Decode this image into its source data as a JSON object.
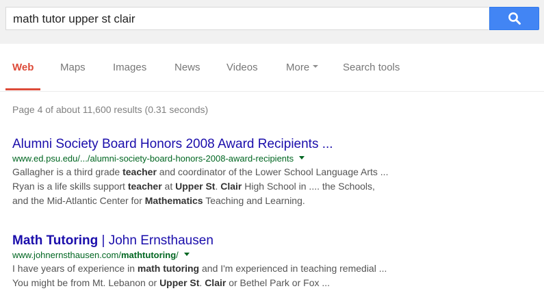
{
  "search": {
    "query": "math tutor upper st clair"
  },
  "nav": {
    "tabs": [
      {
        "label": "Web"
      },
      {
        "label": "Maps"
      },
      {
        "label": "Images"
      },
      {
        "label": "News"
      },
      {
        "label": "Videos"
      },
      {
        "label": "More"
      },
      {
        "label": "Search tools"
      }
    ]
  },
  "stats": "Page 4 of about 11,600 results (0.31 seconds)",
  "results": [
    {
      "title": "Alumni Society Board Honors 2008 Award Recipients ...",
      "url": "www.ed.psu.edu/.../alumni-society-board-honors-2008-award-recipients",
      "snippet": [
        [
          {
            "t": "Gallagher is a third grade "
          },
          {
            "t": "teacher",
            "b": true
          },
          {
            "t": " and coordinator of the Lower School Language Arts ..."
          }
        ],
        [
          {
            "t": "Ryan is a life skills support "
          },
          {
            "t": "teacher",
            "b": true
          },
          {
            "t": " at "
          },
          {
            "t": "Upper St",
            "b": true
          },
          {
            "t": ". "
          },
          {
            "t": "Clair",
            "b": true
          },
          {
            "t": " High School in .... the Schools,"
          }
        ],
        [
          {
            "t": "and the Mid-Atlantic Center for "
          },
          {
            "t": "Mathematics",
            "b": true
          },
          {
            "t": " Teaching and Learning."
          }
        ]
      ]
    },
    {
      "title_parts": [
        {
          "t": "Math Tutoring",
          "b": true
        },
        {
          "t": " | John Ernsthausen"
        }
      ],
      "url_parts": [
        {
          "t": "www.johnernsthausen.com/"
        },
        {
          "t": "mathtutoring",
          "b": true
        },
        {
          "t": "/"
        }
      ],
      "snippet": [
        [
          {
            "t": "I have years of experience in "
          },
          {
            "t": "math tutoring",
            "b": true
          },
          {
            "t": " and I'm experienced in teaching remedial ..."
          }
        ],
        [
          {
            "t": "You might be from Mt. Lebanon or "
          },
          {
            "t": "Upper St",
            "b": true
          },
          {
            "t": ". "
          },
          {
            "t": "Clair",
            "b": true
          },
          {
            "t": " or Bethel Park or Fox ..."
          }
        ]
      ]
    }
  ],
  "colors": {
    "accent": "#dd4b39",
    "link": "#1a0dab",
    "url": "#006621",
    "search_button": "#4285f4"
  }
}
